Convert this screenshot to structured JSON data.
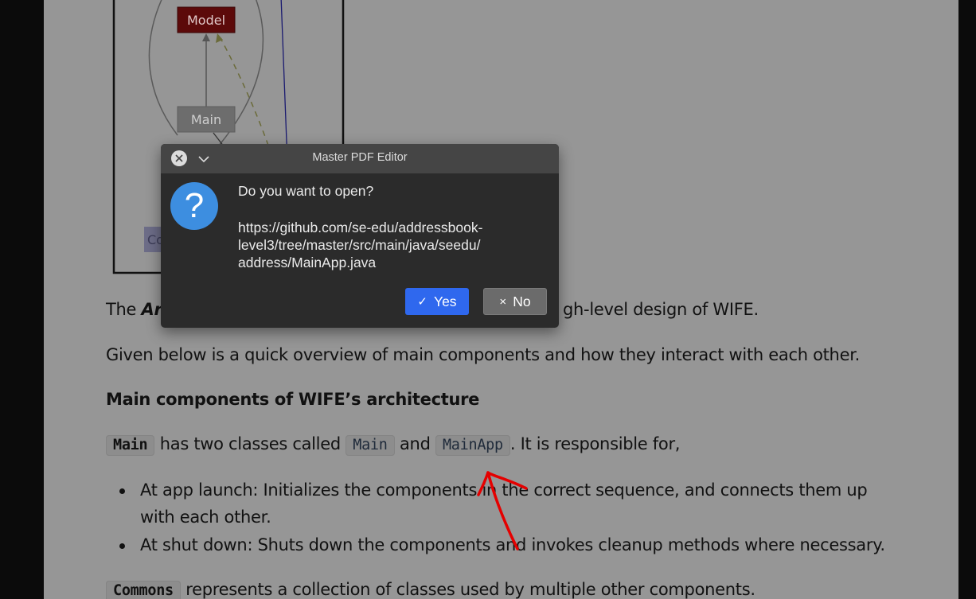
{
  "diagram": {
    "model_label": "Model",
    "main_label": "Main",
    "commons_label_fragment": "Co"
  },
  "content": {
    "intro_prefix": "The ",
    "intro_bold": "Ar",
    "intro_suffix": "gh-level design of WIFE.",
    "overview": "Given below is a quick overview of main components and how they interact with each other.",
    "heading": "Main components of WIFE’s architecture",
    "main_para": {
      "code_main_bold": "Main",
      "text_1": " has two classes called ",
      "code_main": "Main",
      "text_2": " and ",
      "code_mainapp": "MainApp",
      "text_3": ". It is responsible for,"
    },
    "bullets": [
      "At app launch: Initializes the components in the correct sequence, and connects them up",
      "with each other.",
      "At shut down: Shuts down the components and invokes cleanup methods where necessary."
    ],
    "commons_para": {
      "code_commons": "Commons",
      "text": " represents a collection of classes used by multiple other components."
    }
  },
  "dialog": {
    "title": "Master PDF Editor",
    "question": "Do you want to open?",
    "url_lines": [
      "https://github.com/se-edu/addressbook-",
      "level3/tree/master/src/main/java/seedu/",
      "address/MainApp.java"
    ],
    "yes_label": "Yes",
    "no_label": "No",
    "yes_glyph": "✓",
    "no_glyph": "×",
    "icons": [
      "close-icon",
      "chevron-down-icon",
      "question-icon"
    ]
  },
  "colors": {
    "page_background": "#969696",
    "dialog_background": "#2b2b2b",
    "yes_button": "#2f68ee",
    "annotation": "#e50000",
    "model_box": "#5c0a0a"
  }
}
